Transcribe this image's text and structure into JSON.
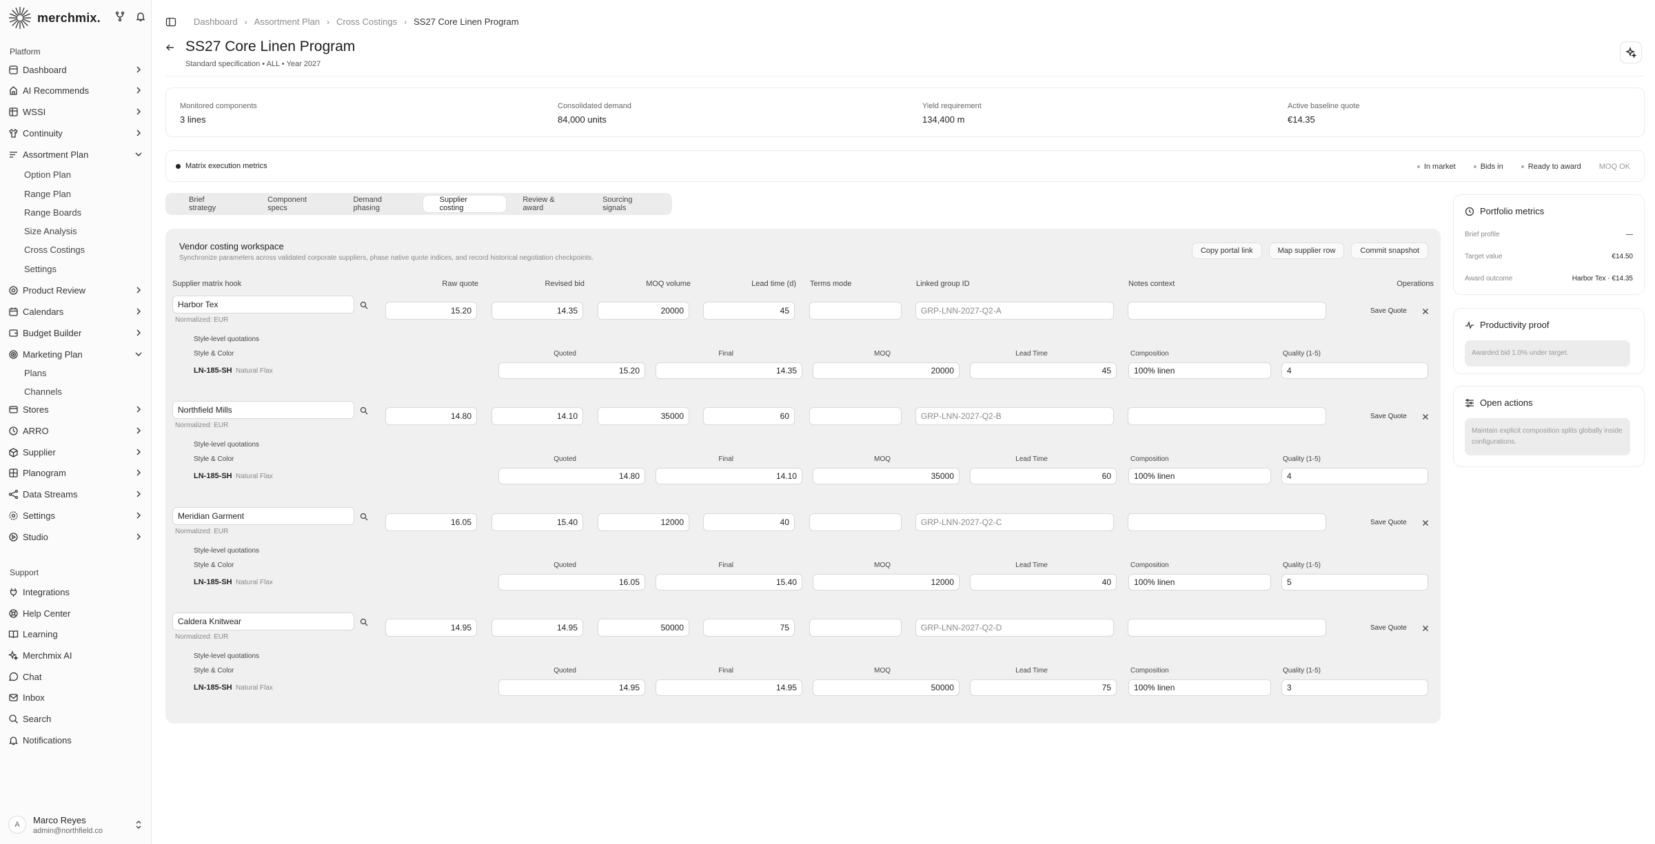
{
  "app": {
    "name": "merchmix.",
    "sidebar": {
      "platform_label": "Platform",
      "support_label": "Support",
      "items": [
        {
          "label": "Dashboard",
          "icon": "dashboard-icon"
        },
        {
          "label": "AI Recommends",
          "icon": "ai-icon"
        },
        {
          "label": "WSSI",
          "icon": "wssi-icon"
        },
        {
          "label": "Continuity",
          "icon": "shirt-icon"
        },
        {
          "label": "Assortment Plan",
          "icon": "assortment-icon"
        },
        {
          "label": "Product Review",
          "icon": "review-icon"
        },
        {
          "label": "Calendars",
          "icon": "calendar-icon"
        },
        {
          "label": "Budget Builder",
          "icon": "budget-icon"
        },
        {
          "label": "Marketing Plan",
          "icon": "marketing-icon"
        },
        {
          "label": "Stores",
          "icon": "stores-icon"
        },
        {
          "label": "ARRO",
          "icon": "arro-icon"
        },
        {
          "label": "Supplier",
          "icon": "supplier-icon"
        },
        {
          "label": "Planogram",
          "icon": "planogram-icon"
        },
        {
          "label": "Data Streams",
          "icon": "data-streams-icon"
        },
        {
          "label": "Settings",
          "icon": "settings-icon"
        },
        {
          "label": "Studio",
          "icon": "studio-icon"
        }
      ],
      "assortment_sub": [
        "Option Plan",
        "Range Plan",
        "Range Boards",
        "Size Analysis",
        "Cross Costings",
        "Settings"
      ],
      "marketing_sub": [
        "Plans",
        "Channels"
      ],
      "support": [
        {
          "label": "Integrations",
          "icon": "integrations-icon"
        },
        {
          "label": "Help Center",
          "icon": "help-icon"
        },
        {
          "label": "Learning",
          "icon": "learning-icon"
        },
        {
          "label": "Merchmix AI",
          "icon": "merchmix-ai-icon"
        },
        {
          "label": "Chat",
          "icon": "chat-icon"
        },
        {
          "label": "Inbox",
          "icon": "inbox-icon"
        },
        {
          "label": "Search",
          "icon": "search-icon"
        },
        {
          "label": "Notifications",
          "icon": "notifications-icon"
        }
      ],
      "user": {
        "initial": "A",
        "name": "Marco Reyes",
        "email": "admin@northfield.co"
      }
    }
  },
  "breadcrumb": [
    "Dashboard",
    "Assortment Plan",
    "Cross Costings",
    "SS27 Core Linen Program"
  ],
  "page": {
    "title": "SS27 Core Linen Program",
    "subtitle": "Standard specification • ALL • Year 2027"
  },
  "metrics": [
    {
      "label": "Monitored components",
      "value": "3 lines"
    },
    {
      "label": "Consolidated demand",
      "value": "84,000 units"
    },
    {
      "label": "Yield requirement",
      "value": "134,400 m"
    },
    {
      "label": "Active baseline quote",
      "value": "€14.35"
    }
  ],
  "exec": {
    "title": "Matrix execution metrics",
    "chips": [
      "In market",
      "Bids in",
      "Ready to award",
      "MOQ OK"
    ]
  },
  "tabs": [
    "Brief strategy",
    "Component specs",
    "Demand phasing",
    "Supplier costing",
    "Review & award",
    "Sourcing signals"
  ],
  "active_tab": "Supplier costing",
  "workspace": {
    "title": "Vendor costing workspace",
    "subtitle": "Synchronize parameters across validated corporate suppliers, phase native quote indices, and record historical negotiation checkpoints.",
    "buttons": [
      "Copy portal link",
      "Map supplier row",
      "Commit snapshot"
    ],
    "headers": {
      "supplier": "Supplier matrix hook",
      "raw": "Raw quote",
      "revised": "Revised bid",
      "moq": "MOQ volume",
      "lead": "Lead time (d)",
      "terms": "Terms mode",
      "group": "Linked group ID",
      "notes": "Notes context",
      "ops": "Operations"
    },
    "normalized": "Normalized: EUR",
    "save_label": "Save Quote",
    "style_level": "Style-level quotations",
    "style_headers": {
      "style": "Style & Color",
      "quoted": "Quoted",
      "final": "Final",
      "moq": "MOQ",
      "lead": "Lead Time",
      "composition": "Composition",
      "quality": "Quality (1-5)"
    },
    "suppliers": [
      {
        "name": "Harbor Tex",
        "raw": "15.20",
        "revised": "14.35",
        "moq": "20000",
        "lead": "45",
        "group": "GRP-LNN-2027-Q2-A",
        "style": {
          "code": "LN-185-SH",
          "color": "Natural Flax",
          "quoted": "15.20",
          "final": "14.35",
          "moq": "20000",
          "lead": "45",
          "composition": "100% linen",
          "quality": "4"
        }
      },
      {
        "name": "Northfield Mills",
        "raw": "14.80",
        "revised": "14.10",
        "moq": "35000",
        "lead": "60",
        "group": "GRP-LNN-2027-Q2-B",
        "style": {
          "code": "LN-185-SH",
          "color": "Natural Flax",
          "quoted": "14.80",
          "final": "14.10",
          "moq": "35000",
          "lead": "60",
          "composition": "100% linen",
          "quality": "4"
        }
      },
      {
        "name": "Meridian Garment",
        "raw": "16.05",
        "revised": "15.40",
        "moq": "12000",
        "lead": "40",
        "group": "GRP-LNN-2027-Q2-C",
        "style": {
          "code": "LN-185-SH",
          "color": "Natural Flax",
          "quoted": "16.05",
          "final": "15.40",
          "moq": "12000",
          "lead": "40",
          "composition": "100% linen",
          "quality": "5"
        }
      },
      {
        "name": "Caldera Knitwear",
        "raw": "14.95",
        "revised": "14.95",
        "moq": "50000",
        "lead": "75",
        "group": "GRP-LNN-2027-Q2-D",
        "style": {
          "code": "LN-185-SH",
          "color": "Natural Flax",
          "quoted": "14.95",
          "final": "14.95",
          "moq": "50000",
          "lead": "75",
          "composition": "100% linen",
          "quality": "3"
        }
      }
    ]
  },
  "right": {
    "portfolio": {
      "title": "Portfolio metrics",
      "rows": [
        {
          "label": "Brief profile",
          "value": "—"
        },
        {
          "label": "Target value",
          "value": "€14.50"
        },
        {
          "label": "Award outcome",
          "value": "Harbor Tex · €14.35"
        }
      ]
    },
    "productivity": {
      "title": "Productivity proof",
      "note": "Awarded bid 1.0% under target."
    },
    "actions": {
      "title": "Open actions",
      "note": "Maintain explicit composition splits globally inside configurations."
    }
  }
}
